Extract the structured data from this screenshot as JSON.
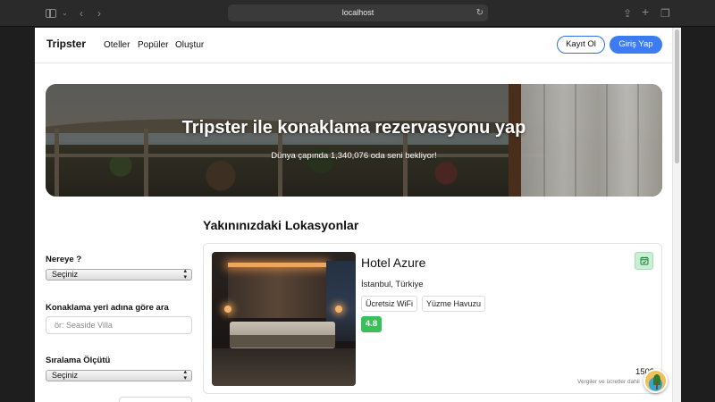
{
  "browser": {
    "url": "localhost",
    "icons": {
      "sidebar": "sidebar-icon",
      "back": "chevron-left-icon",
      "forward": "chevron-right-icon",
      "reload": "reload-icon",
      "share": "share-icon",
      "new_tab": "plus-icon",
      "tabs": "tabs-icon"
    }
  },
  "navbar": {
    "brand": "Tripster",
    "links": [
      "Oteller",
      "Popüler",
      "Oluştur"
    ],
    "register_label": "Kayıt Ol",
    "login_label": "Giriş Yap"
  },
  "hero": {
    "title": "Tripster ile konaklama rezervasyonu yap",
    "subtitle": "Dünya çapında 1,340,076 oda seni bekliyor!"
  },
  "filters": {
    "destination": {
      "label": "Nereye ?",
      "selected": "Seçiniz"
    },
    "name_search": {
      "label": "Konaklama yeri adına göre ara",
      "placeholder": "ör: Seaside Villa"
    },
    "sort": {
      "label": "Sıralama Ölçütü",
      "selected": "Seçiniz"
    }
  },
  "main": {
    "section_title": "Yakınınızdaki Lokasyonlar",
    "hotels": [
      {
        "name": "Hotel Azure",
        "location": "İstanbul, Türkiye",
        "amenities": [
          "Ücretsiz WiFi",
          "Yüzme Havuzu"
        ],
        "rating": "4.8",
        "price": "150$",
        "price_note": "Vergiler ve ücretler dahil"
      }
    ]
  },
  "colors": {
    "primary": "#3b7df0",
    "rating_bg": "#3bbf5b",
    "calendar_bg": "#c9f0d3"
  }
}
